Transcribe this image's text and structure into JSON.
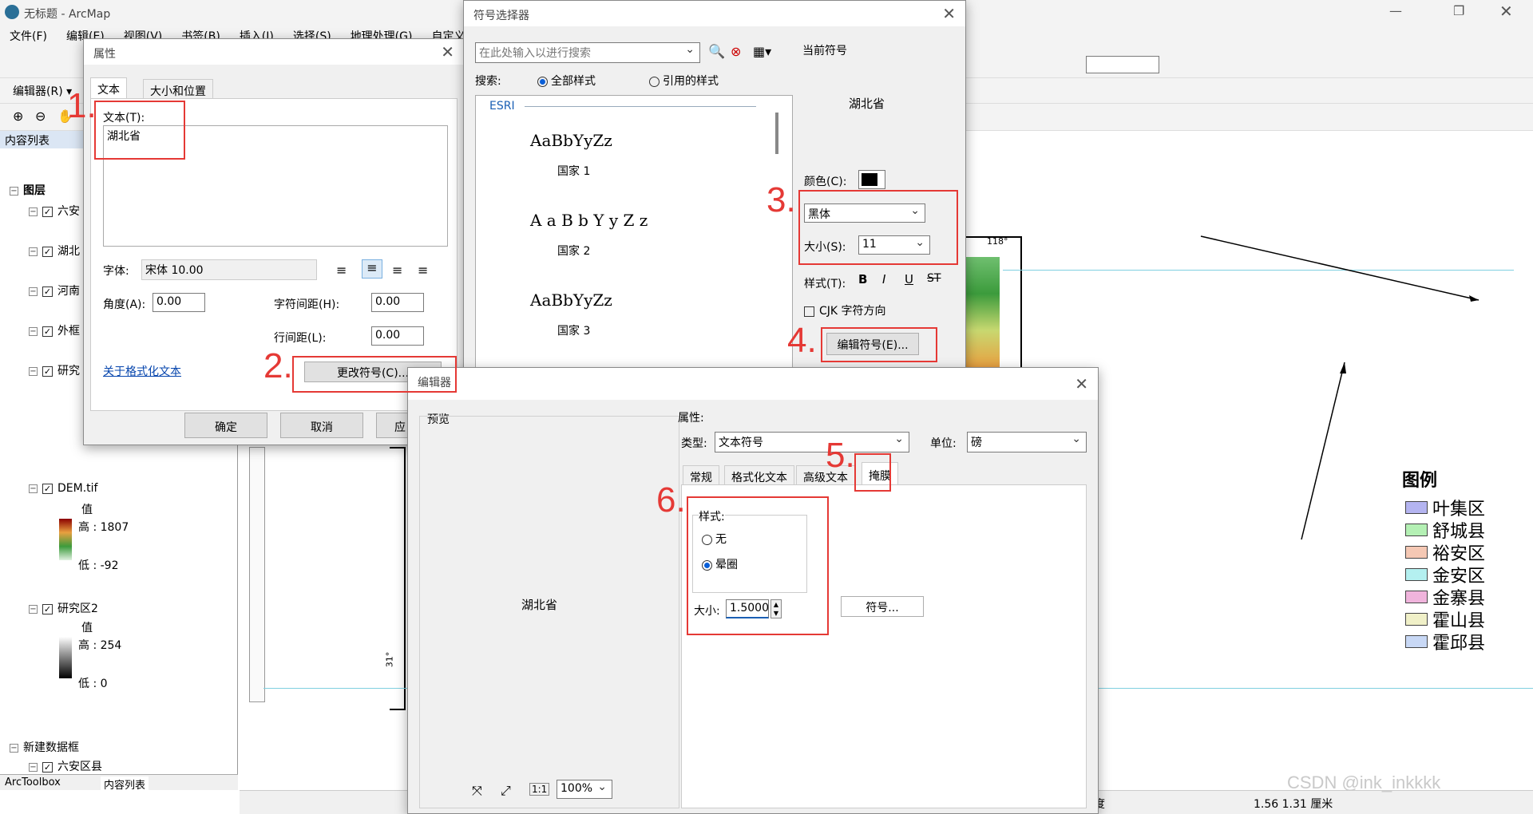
{
  "app": {
    "title": "无标题 - ArcMap"
  },
  "menu": [
    "文件(F)",
    "编辑(E)",
    "视图(V)",
    "书签(B)",
    "插入(I)",
    "选择(S)",
    "地理处理(G)",
    "自定义(C)"
  ],
  "toolbar": {
    "editor_label": "编辑器(R) ▾"
  },
  "toc": {
    "title": "内容列表",
    "layers_root": "图层",
    "items": [
      "六安",
      "湖北",
      "河南",
      "外框",
      "研究"
    ],
    "dem_label": "DEM.tif",
    "dem_value_label": "值",
    "dem_high": "高 : 1807",
    "dem_low": "低 : -92",
    "area2_label": "研究区2",
    "area2_value_label": "值",
    "area2_high": "高 : 254",
    "area2_low": "低 : 0",
    "new_frame": "新建数据框",
    "new_frame_child": "六安区县",
    "tab_toolbox": "ArcToolbox",
    "tab_toc": "内容列表"
  },
  "status": {
    "coords": "1.56  1.31 厘米",
    "unit": "度"
  },
  "legend": {
    "title": "图例",
    "items": [
      {
        "label": "叶集区",
        "color": "#b4b4f0"
      },
      {
        "label": "舒城县",
        "color": "#b4f0b4"
      },
      {
        "label": "裕安区",
        "color": "#f5c8b4"
      },
      {
        "label": "金安区",
        "color": "#b4f0f0"
      },
      {
        "label": "金寨县",
        "color": "#f0b4dc"
      },
      {
        "label": "霍山县",
        "color": "#f0f0c8"
      },
      {
        "label": "霍邱县",
        "color": "#c8d8f5"
      }
    ]
  },
  "map_labels": {
    "lon": "118°",
    "lat": "31°"
  },
  "props_dialog": {
    "title": "属性",
    "tabs": [
      "文本",
      "大小和位置"
    ],
    "text_label": "文本(T):",
    "text_value": "湖北省",
    "font_label": "字体:",
    "font_value": "宋体 10.00",
    "angle_label": "角度(A):",
    "angle_value": "0.00",
    "char_spacing_label": "字符间距(H):",
    "char_spacing_value": "0.00",
    "line_spacing_label": "行间距(L):",
    "line_spacing_value": "0.00",
    "about_link": "关于格式化文本",
    "change_symbol": "更改符号(C)...",
    "ok": "确定",
    "cancel": "取消",
    "apply": "应"
  },
  "symbol_dialog": {
    "title": "符号选择器",
    "search_placeholder": "在此处输入以进行搜索",
    "search_label": "搜索:",
    "all_styles": "全部样式",
    "ref_styles": "引用的样式",
    "group": "ESRI",
    "samples": [
      {
        "text": "AaBbYyZz",
        "name": "国家 1"
      },
      {
        "text": "A a B b Y y Z z",
        "name": "国家 2"
      },
      {
        "text": "AaBbYyZz",
        "name": "国家 3"
      }
    ],
    "current_label": "当前符号",
    "preview": "湖北省",
    "color_label": "颜色(C):",
    "font_value": "黑体",
    "size_label": "大小(S):",
    "size_value": "11",
    "style_label": "样式(T):",
    "cjk_label": "CJK 字符方向",
    "edit_button": "编辑符号(E)..."
  },
  "editor_dialog": {
    "title": "编辑器",
    "preview_label": "预览",
    "preview_text": "湖北省",
    "props_label": "属性:",
    "type_label": "类型:",
    "type_value": "文本符号",
    "unit_label": "单位:",
    "unit_value": "磅",
    "tabs": [
      "常规",
      "格式化文本",
      "高级文本",
      "掩膜"
    ],
    "style_group": "样式:",
    "opt_none": "无",
    "opt_halo": "晕圈",
    "size_label": "大小:",
    "size_value": "1.5000",
    "symbol_button": "符号...",
    "zoom_value": "100%",
    "zoom_fit": "1:1"
  },
  "steps": [
    "1.",
    "2.",
    "3.",
    "4.",
    "5.",
    "6."
  ],
  "watermark": "CSDN @ink_inkkkk"
}
